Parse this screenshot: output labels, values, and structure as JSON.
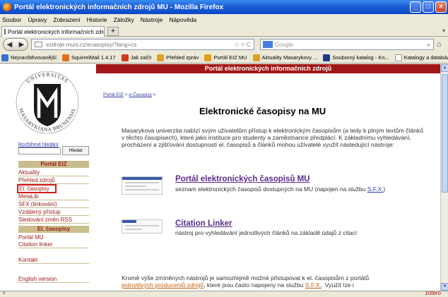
{
  "window": {
    "title": "Portál elektronických informačních zdrojů MU - Mozilla Firefox"
  },
  "menu": [
    "Soubor",
    "Úpravy",
    "Zobrazení",
    "Historie",
    "Záložky",
    "Nástroje",
    "Nápověda"
  ],
  "tab": {
    "label": "Portál elektronických informačních zdrojů MU",
    "new_tab": "+"
  },
  "urlbar": {
    "host": "ezdroje.muni.cz",
    "path": "/ecasopisy/?lang=cs"
  },
  "searchbox": {
    "placeholder": "Google"
  },
  "bookmarks": [
    {
      "label": "Nejnavštěvovanější",
      "color": "#3a6fd0"
    },
    {
      "label": "SquirrelMail 1.4.17",
      "color": "#e07020"
    },
    {
      "label": "Jak začít",
      "color": "#d03a20"
    },
    {
      "label": "Přehled zpráv",
      "color": "#e0a020"
    },
    {
      "label": "Portál EIZ MU",
      "color": "#e0a020"
    },
    {
      "label": "Aktuality Masarykovy ...",
      "color": "#e0a020"
    },
    {
      "label": "Souborný katalog - Kn...",
      "color": "#1a3a8a"
    },
    {
      "label": "Katalogy a databáze ...",
      "color": "#ffffff"
    }
  ],
  "logo": {
    "text": "UNIVERSITAS MASARYKIANA BRUNENSIS",
    "mark": "M"
  },
  "sidebar": {
    "advanced_search": "Rozšířené hledání",
    "search_button": "Hledat",
    "section1": "Portál EIZ",
    "items1": [
      "Aktuality",
      "Přehled zdrojů",
      "El. časopisy",
      "MetaLib",
      "SFX (linkování)",
      "Vzdálený přístup",
      "Sledování změn RSS"
    ],
    "section2": "El. časopisy",
    "items2": [
      "Portál MU",
      "Citation linker"
    ],
    "contact": "Kontakt",
    "english": "English version"
  },
  "page": {
    "header": "Portál elektronických informačních zdrojů",
    "breadcrumb_home": "Portál EIZ",
    "breadcrumb_sep1": " > ",
    "breadcrumb_current": "e-Časopisy",
    "breadcrumb_sep2": " >",
    "title": "Elektronické časopisy na MU",
    "intro": "Masarykova univerzita nabízí svým uživatelům přístup k elektronickým časopisům (a tedy k plným textům článků v těchto časopisech), které jako instituce pro studenty a zaměstnance předplácí. K základnímu vyhledávání, procházení a zjišťování dostupnosti el. časopisů a článků mohou uživatelé využít následující nástroje:",
    "resource1": {
      "title": "Portál elektronických časopisů MU",
      "desc": "seznam elektronických časopisů dostupných na MU (napojen na službu ",
      "link": "S.F.X.",
      "desc_end": ")"
    },
    "resource2": {
      "title": "Citation Linker",
      "desc": "nástroj pro vyhledávání jednotlivých článků na základě údajů z citací"
    },
    "outro_start": "Kromě výše zmíněných nástrojů je samozřejmě možné přistupovat k el. časopisům z portálů",
    "outro_link": "jednotlivých producentů zdrojů",
    "outro_mid": ", které jsou často napojeny na službu ",
    "outro_link2": "S.F.X.",
    "outro_end": ". Využít lze i"
  },
  "status": {
    "close": "x",
    "zotero": "zotero"
  }
}
